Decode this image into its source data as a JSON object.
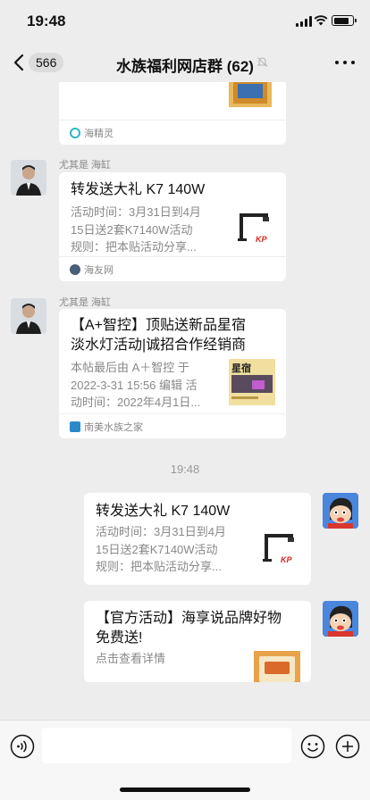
{
  "status": {
    "time": "19:48"
  },
  "nav": {
    "unread_count": "566",
    "title": "水族福利网店群 (62)"
  },
  "messages": [
    {
      "source": "海精灵"
    },
    {
      "sender": "尤其是 海缸",
      "title": "转发送大礼 K7 140W",
      "desc": [
        "活动时间：3月31日到4月",
        "15日送2套K7140W活动",
        "规则：把本贴活动分享..."
      ],
      "source": "海友网",
      "thumb_text": "KP"
    },
    {
      "sender": "尤其是 海缸",
      "title": [
        "【A+智控】顶贴送新品星宿",
        "淡水灯活动|诚招合作经销商"
      ],
      "desc": [
        "本帖最后由 A＋智控 于",
        "2022-3-31 15:56 编辑 活",
        "动时间：2022年4月1日..."
      ],
      "source": "南美水族之家",
      "thumb_text": "星宿"
    }
  ],
  "timestamp": "19:48",
  "my_messages": [
    {
      "title": "转发送大礼 K7 140W",
      "desc": [
        "活动时间：3月31日到4月",
        "15日送2套K7140W活动",
        "规则：把本贴活动分享..."
      ],
      "thumb_text": "KP"
    },
    {
      "title": [
        "【官方活动】海享说品牌好物",
        "免费送!"
      ],
      "desc": [
        "点击查看详情"
      ]
    }
  ],
  "colors": {
    "background": "#ededed",
    "card": "#ffffff",
    "meta_text": "#888888"
  }
}
